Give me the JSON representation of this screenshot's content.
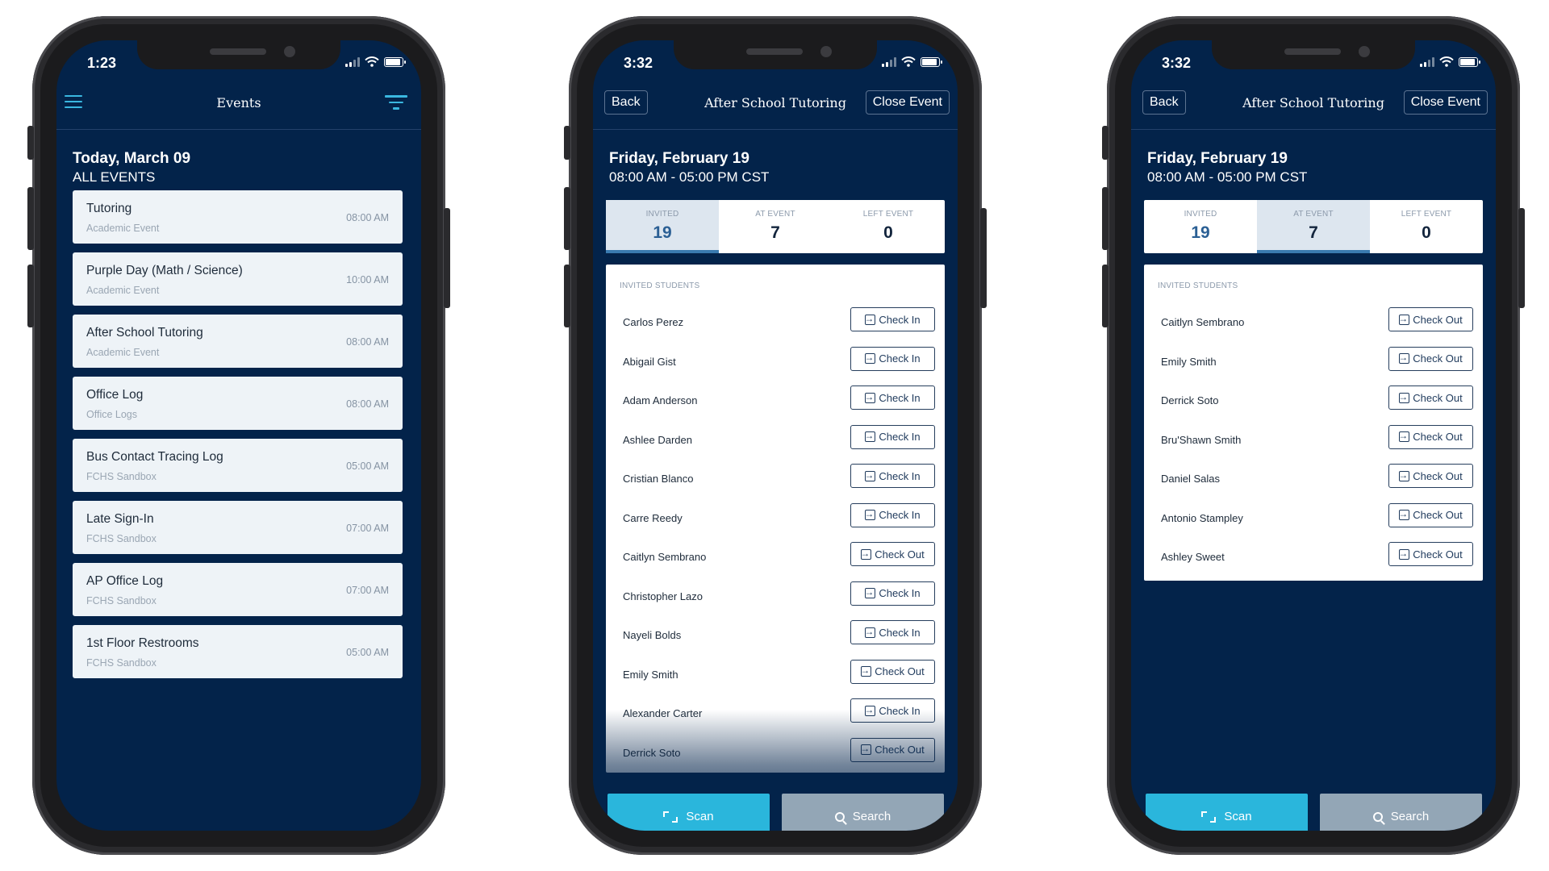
{
  "phone1": {
    "time": "1:23",
    "title": "Events",
    "date": "Today, March 09",
    "subtitle": "ALL EVENTS",
    "events": [
      {
        "title": "Tutoring",
        "sub": "Academic Event",
        "time": "08:00 AM"
      },
      {
        "title": "Purple Day (Math / Science)",
        "sub": "Academic Event",
        "time": "10:00 AM"
      },
      {
        "title": "After School Tutoring",
        "sub": "Academic Event",
        "time": "08:00 AM"
      },
      {
        "title": "Office Log",
        "sub": "Office Logs",
        "time": "08:00 AM"
      },
      {
        "title": "Bus Contact Tracing Log",
        "sub": "FCHS Sandbox",
        "time": "05:00 AM"
      },
      {
        "title": "Late Sign-In",
        "sub": "FCHS Sandbox",
        "time": "07:00 AM"
      },
      {
        "title": "AP Office Log",
        "sub": "FCHS Sandbox",
        "time": "07:00 AM"
      },
      {
        "title": "1st Floor Restrooms",
        "sub": "FCHS Sandbox",
        "time": "05:00 AM"
      }
    ]
  },
  "phone2": {
    "time": "3:32",
    "back": "Back",
    "title": "After School Tutoring",
    "close": "Close Event",
    "date": "Friday, February 19",
    "hours": "08:00 AM - 05:00 PM CST",
    "stats": [
      {
        "label": "INVITED",
        "value": "19"
      },
      {
        "label": "AT EVENT",
        "value": "7"
      },
      {
        "label": "LEFT EVENT",
        "value": "0"
      }
    ],
    "list_header": "INVITED STUDENTS",
    "students": [
      {
        "name": "Carlos Perez",
        "action": "Check In"
      },
      {
        "name": "Abigail Gist",
        "action": "Check In"
      },
      {
        "name": "Adam Anderson",
        "action": "Check In"
      },
      {
        "name": "Ashlee Darden",
        "action": "Check In"
      },
      {
        "name": "Cristian Blanco",
        "action": "Check In"
      },
      {
        "name": "Carre Reedy",
        "action": "Check In"
      },
      {
        "name": "Caitlyn Sembrano",
        "action": "Check Out"
      },
      {
        "name": "Christopher Lazo",
        "action": "Check In"
      },
      {
        "name": "Nayeli Bolds",
        "action": "Check In"
      },
      {
        "name": "Emily Smith",
        "action": "Check Out"
      },
      {
        "name": "Alexander Carter",
        "action": "Check In"
      },
      {
        "name": "Derrick Soto",
        "action": "Check Out"
      }
    ],
    "scan": "Scan",
    "search": "Search"
  },
  "phone3": {
    "time": "3:32",
    "back": "Back",
    "title": "After School Tutoring",
    "close": "Close Event",
    "date": "Friday, February 19",
    "hours": "08:00 AM - 05:00 PM CST",
    "stats": [
      {
        "label": "INVITED",
        "value": "19"
      },
      {
        "label": "AT EVENT",
        "value": "7"
      },
      {
        "label": "LEFT EVENT",
        "value": "0"
      }
    ],
    "list_header": "INVITED STUDENTS",
    "students": [
      {
        "name": "Caitlyn Sembrano",
        "action": "Check Out"
      },
      {
        "name": "Emily Smith",
        "action": "Check Out"
      },
      {
        "name": "Derrick Soto",
        "action": "Check Out"
      },
      {
        "name": "Bru'Shawn Smith",
        "action": "Check Out"
      },
      {
        "name": "Daniel Salas",
        "action": "Check Out"
      },
      {
        "name": "Antonio Stampley",
        "action": "Check Out"
      },
      {
        "name": "Ashley Sweet",
        "action": "Check Out"
      }
    ],
    "scan": "Scan",
    "search": "Search"
  }
}
